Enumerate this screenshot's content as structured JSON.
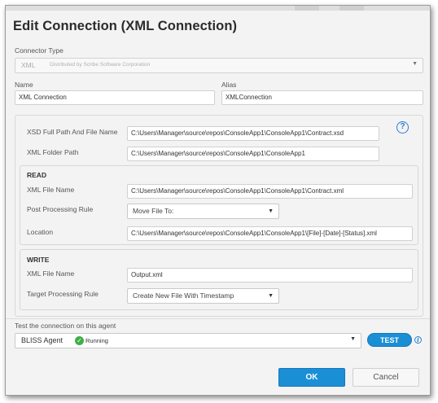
{
  "dialog": {
    "title": "Edit Connection (XML Connection)"
  },
  "connector": {
    "label": "Connector Type",
    "value": "XML",
    "publisher": "Distributed by Scribe Software Corporation"
  },
  "name": {
    "label": "Name",
    "value": "XML Connection"
  },
  "alias": {
    "label": "Alias",
    "value": "XMLConnection"
  },
  "xsd": {
    "label": "XSD Full Path And File Name",
    "value": "C:\\Users\\Manager\\source\\repos\\ConsoleApp1\\ConsoleApp1\\Contract.xsd"
  },
  "xml_folder": {
    "label": "XML Folder Path",
    "value": "C:\\Users\\Manager\\source\\repos\\ConsoleApp1\\ConsoleApp1"
  },
  "read": {
    "title": "READ",
    "file_label": "XML File Name",
    "file_value": "C:\\Users\\Manager\\source\\repos\\ConsoleApp1\\ConsoleApp1\\Contract.xml",
    "rule_label": "Post Processing Rule",
    "rule_value": "Move File To:",
    "location_label": "Location",
    "location_value": "C:\\Users\\Manager\\source\\repos\\ConsoleApp1\\ConsoleApp1\\[File]-[Date]-[Status].xml"
  },
  "write": {
    "title": "WRITE",
    "file_label": "XML File Name",
    "file_value": "Output.xml",
    "rule_label": "Target Processing Rule",
    "rule_value": "Create New File With Timestamp"
  },
  "test": {
    "label": "Test the connection on this agent",
    "agent": "BLISS Agent",
    "status": "Running",
    "button": "TEST"
  },
  "buttons": {
    "ok": "OK",
    "cancel": "Cancel"
  },
  "icons": {
    "help": "question-circle-icon",
    "info": "info-icon",
    "status": "check-circle-icon",
    "dropdown": "chevron-down-icon"
  },
  "colors": {
    "accent": "#1b8fd6",
    "status_ok": "#3fae49"
  }
}
